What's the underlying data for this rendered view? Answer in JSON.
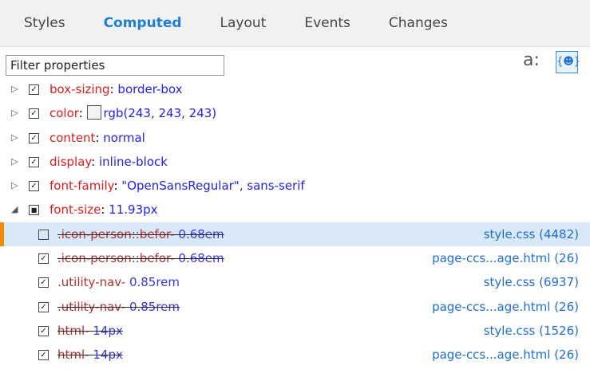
{
  "tabs": [
    "Styles",
    "Computed",
    "Layout",
    "Events",
    "Changes"
  ],
  "filter_placeholder": "Filter properties",
  "toolbar": {
    "a_label": "a:",
    "b_icon": "{☻}"
  },
  "properties": [
    {
      "name": "box-sizing",
      "value": "border-box"
    },
    {
      "name": "color",
      "value": "rgb(243, 243, 243)"
    },
    {
      "name": "content",
      "value": "normal"
    },
    {
      "name": "display",
      "value": "inline-block"
    },
    {
      "name": "font-family",
      "value": "\"OpenSansRegular\", sans-serif"
    },
    {
      "name": "font-size",
      "value": "11.93px"
    }
  ],
  "rules": [
    {
      "selector": ".icon-person::befor",
      "value": "0.68em",
      "source": "style.css (4482)",
      "checked": false,
      "struck": true
    },
    {
      "selector": ".icon-person::befor",
      "value": "0.68em",
      "source": "page-ccs...age.html (26)",
      "checked": true,
      "struck": true
    },
    {
      "selector": ".utility-nav",
      "value": "0.85rem",
      "source": "style.css (6937)",
      "checked": true,
      "struck": false
    },
    {
      "selector": ".utility-nav",
      "value": "0.85rem",
      "source": "page-ccs...age.html (26)",
      "checked": true,
      "struck": true
    },
    {
      "selector": "html",
      "value": "14px",
      "source": "style.css (1526)",
      "checked": true,
      "struck": true
    },
    {
      "selector": "html",
      "value": "14px",
      "source": "page-ccs...age.html (26)",
      "checked": true,
      "struck": true
    }
  ],
  "sep": "- ",
  "colon": ": ",
  "check": "✓",
  "tri_right": "▷",
  "tri_down": "◢"
}
